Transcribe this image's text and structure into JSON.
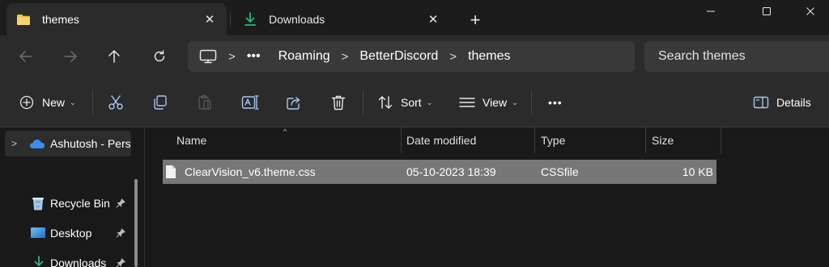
{
  "tabs": [
    {
      "label": "themes",
      "icon": "folder-icon"
    },
    {
      "label": "Downloads",
      "icon": "download-icon"
    }
  ],
  "address": {
    "overflow": "•••",
    "crumbs": [
      "Roaming",
      "BetterDiscord",
      "themes"
    ]
  },
  "search": {
    "placeholder": "Search themes"
  },
  "toolbar": {
    "new_label": "New",
    "sort_label": "Sort",
    "view_label": "View",
    "more_label": "•••",
    "details_label": "Details"
  },
  "nav_pane": {
    "items": [
      {
        "label": "Ashutosh - Perso",
        "icon": "onedrive-icon"
      },
      {
        "label": "Recycle Bin",
        "icon": "recycle-bin-icon"
      },
      {
        "label": "Desktop",
        "icon": "desktop-icon"
      },
      {
        "label": "Downloads",
        "icon": "download-icon"
      }
    ]
  },
  "files": {
    "columns": [
      "Name",
      "Date modified",
      "Type",
      "Size"
    ],
    "rows": [
      {
        "name": "ClearVision_v6.theme.css",
        "date": "05-10-2023 18:39",
        "type": "CSSfile",
        "size": "10 KB"
      }
    ]
  },
  "colors": {
    "accent_folder": "#f4c04a",
    "accent_download": "#2eb67d",
    "onedrive": "#3a8ee6",
    "selection": "#777777"
  }
}
